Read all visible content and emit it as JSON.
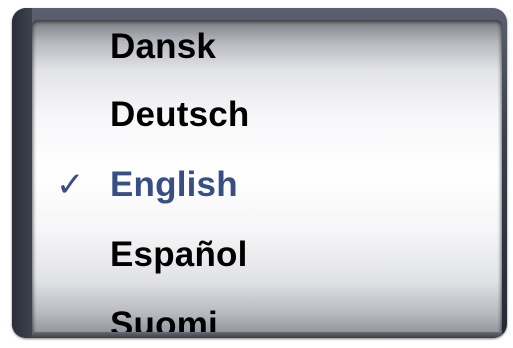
{
  "picker": {
    "selected_index": 2,
    "checkmark": "✓",
    "items": [
      {
        "label": "Dansk"
      },
      {
        "label": "Deutsch"
      },
      {
        "label": "English"
      },
      {
        "label": "Español"
      },
      {
        "label": "Suomi"
      }
    ]
  },
  "colors": {
    "selected_text": "#384f85",
    "text": "#000000"
  }
}
